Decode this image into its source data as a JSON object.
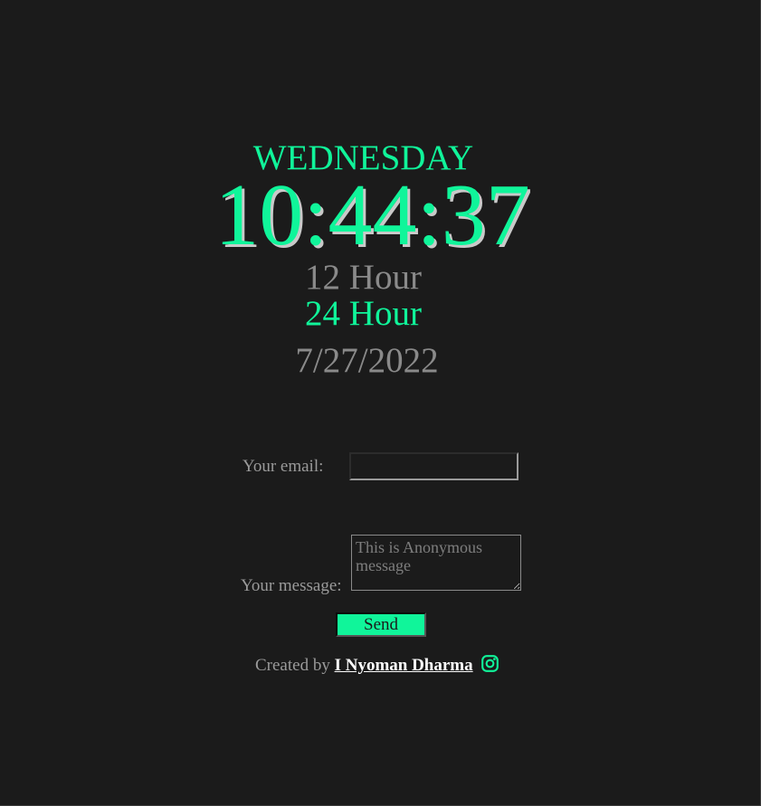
{
  "clock": {
    "day": "WEDNESDAY",
    "time": "10:44:37",
    "format_12": "12 Hour",
    "format_24": "24 Hour",
    "date": "7/27/2022"
  },
  "form": {
    "email_label": "Your email:",
    "email_value": "",
    "message_label": "Your message:",
    "message_placeholder": "This is Anonymous message",
    "send_label": "Send"
  },
  "footer": {
    "created_by": "Created by",
    "author": "I Nyoman Dharma",
    "social_icon": "instagram-icon"
  },
  "colors": {
    "background": "#1b1b1b",
    "accent": "#10f59a",
    "muted_text": "#8a8a8a"
  }
}
